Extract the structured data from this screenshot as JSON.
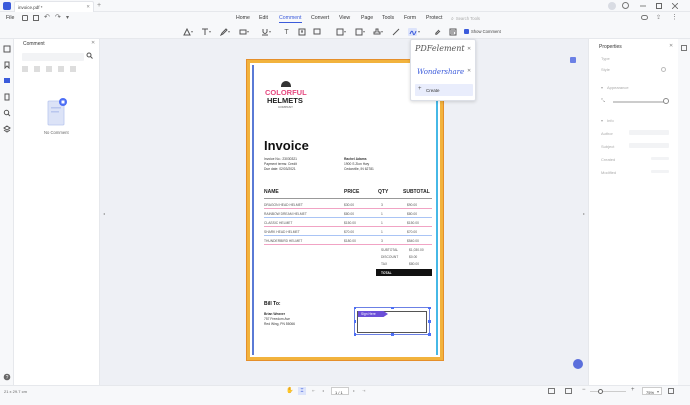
{
  "window": {
    "tab_title": "invoice.pdf *"
  },
  "menu": {
    "file": "File",
    "items": [
      "Home",
      "Edit",
      "Comment",
      "Convert",
      "View",
      "Page",
      "Tools",
      "Form",
      "Protect"
    ],
    "active": "Comment",
    "search_placeholder": "Search Tools"
  },
  "toolbar": {
    "show_comment": "Show Comment"
  },
  "comment_panel": {
    "title": "Comment",
    "search_placeholder": "",
    "empty_text": "No Comment"
  },
  "signature_popup": {
    "signature1": "PDFelement",
    "signature2": "Wondershare",
    "create_label": "Create"
  },
  "properties": {
    "title": "Properties",
    "type_label": "Type",
    "style_label": "Style",
    "appearance_label": "Appearance",
    "info_label": "Info",
    "author_label": "Author",
    "subject_label": "Subject",
    "created_label": "Created",
    "modified_label": "Modified"
  },
  "invoice": {
    "logo_line1": "COLORFUL",
    "logo_line2": "HELMETS",
    "logo_line3": "COMPANY",
    "title": "Invoice",
    "invoice_no": "Invoice No.: 23030321",
    "payment_terms": "Payment terms: Credit",
    "due_date": "Due date: 02/03/2021",
    "customer_name": "Rachel Adams",
    "customer_address1": "1900 S Zion Hwy",
    "customer_address2": "Cedarville, IN 62781",
    "headers": [
      "NAME",
      "PRICE",
      "QTY",
      "SUBTOTAL"
    ],
    "rows": [
      [
        "DRAGON HEAD HELMET",
        "$30.00",
        "3",
        "$90.00"
      ],
      [
        "RAINBOW DREAM HELMET",
        "$80.00",
        "1",
        "$80.00"
      ],
      [
        "CLASSIC HELMET",
        "$150.00",
        "1",
        "$150.00"
      ],
      [
        "SHARK HEAD HELMET",
        "$70.00",
        "1",
        "$70.00"
      ],
      [
        "THUNDERBIRD HELMET",
        "$180.00",
        "3",
        "$540.00"
      ]
    ],
    "subtotal_label": "SUBTOTAL",
    "subtotal_value": "$1,030.00",
    "discount_label": "DISCOUNT",
    "discount_value": "$0.00",
    "tax_label": "TAX",
    "tax_value": "$80.00",
    "total_label": "TOTAL",
    "bill_to": "Bill To:",
    "bill_name": "Brian Weaver",
    "bill_address1": "757 Freedom Ave",
    "bill_address2": "Red Wing, PN 55066",
    "sign_here": "Sign Here"
  },
  "status": {
    "page_size": "21 x 29.7 cm",
    "page_number": "1 / 1",
    "zoom": "75%"
  }
}
